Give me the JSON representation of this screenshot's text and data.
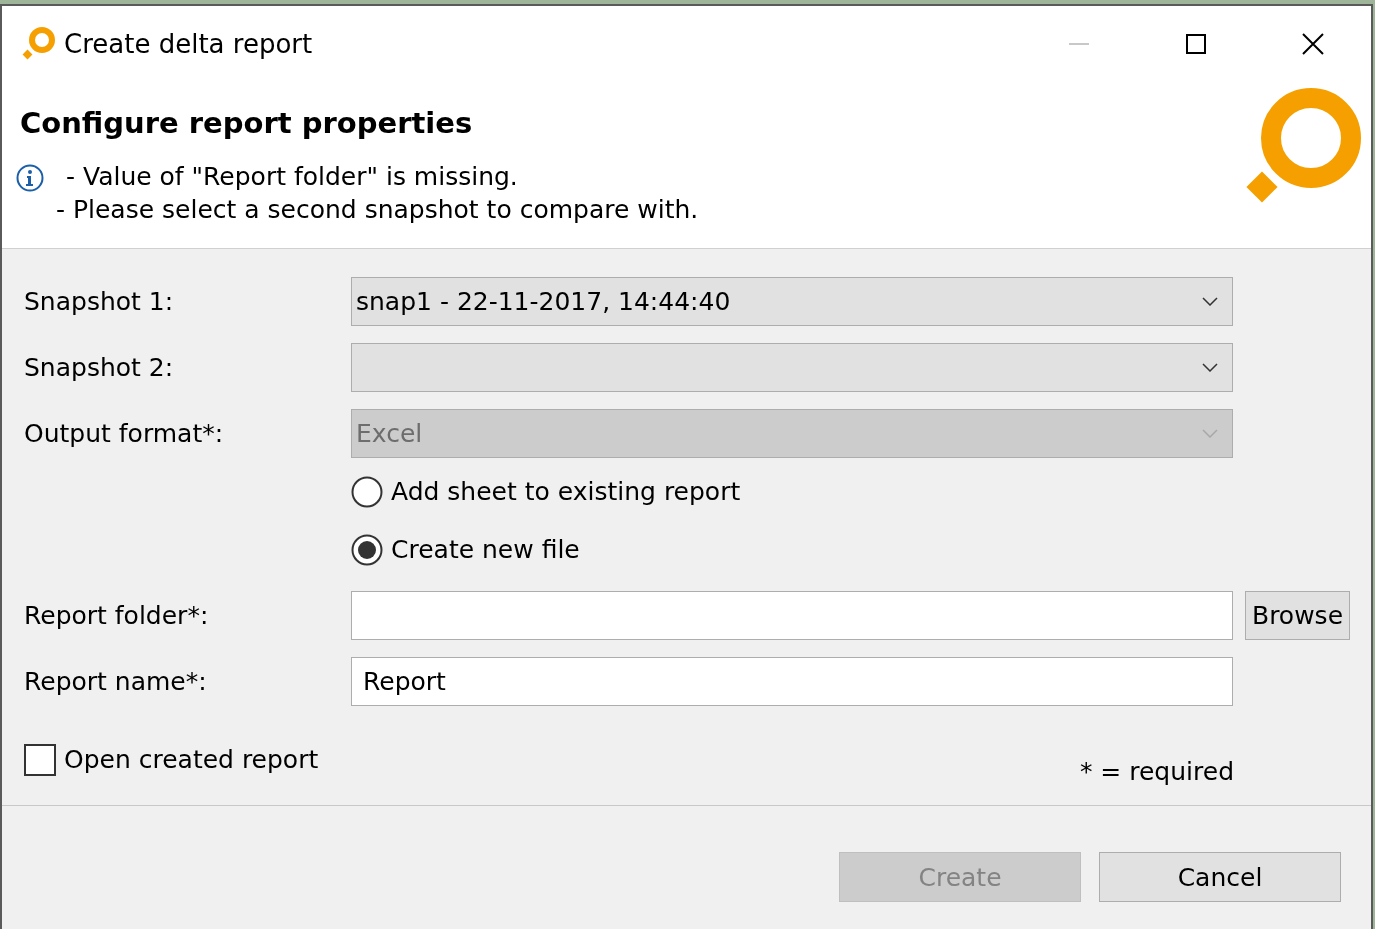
{
  "window": {
    "title": "Create delta report",
    "controls": [
      {
        "kind": "minimize",
        "disabled": true
      },
      {
        "kind": "maximize",
        "disabled": false
      },
      {
        "kind": "close",
        "disabled": false
      }
    ]
  },
  "header": {
    "title": "Configure report properties",
    "messages": [
      "- Value of \"Report folder\" is missing.",
      "- Please select a second snapshot to compare with."
    ]
  },
  "fields": [
    {
      "kind": "dropdown",
      "label": "Snapshot 1:",
      "value": "snap1 - 22-11-2017, 14:44:40",
      "disabled": false
    },
    {
      "kind": "dropdown",
      "label": "Snapshot 2:",
      "disabled": false
    },
    {
      "kind": "dropdown",
      "label": "Output format*:",
      "value": "Excel",
      "disabled": true
    },
    {
      "kind": "radios",
      "options": [
        {
          "label": "Add sheet to existing report",
          "selected": false
        },
        {
          "label": "Create new file",
          "selected": true
        }
      ]
    },
    {
      "kind": "text",
      "label": "Report folder*:",
      "button": "Browse"
    },
    {
      "kind": "text",
      "label": "Report name*:",
      "value": "Report"
    }
  ],
  "open_report": {
    "label": "Open created report",
    "checked": false
  },
  "required_note": "* = required",
  "buttons": [
    {
      "label": "Create",
      "disabled": true
    },
    {
      "label": "Cancel",
      "disabled": false
    }
  ]
}
